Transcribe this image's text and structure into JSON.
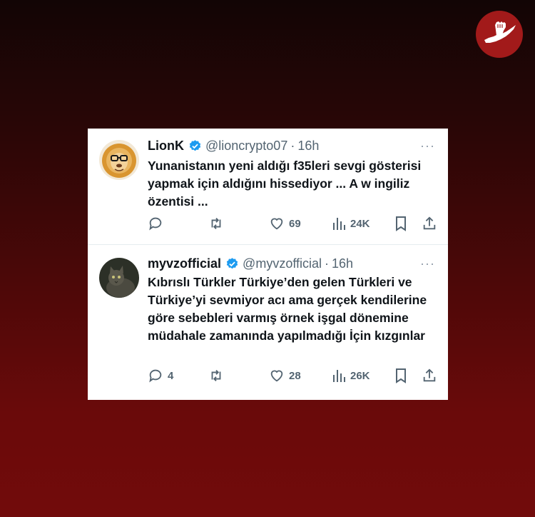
{
  "colors": {
    "background_top": "#120505",
    "background_bottom": "#720b0b",
    "logo_bg": "#a21a1a",
    "verified": "#1d9bf0",
    "name_text": "#0f1419",
    "secondary_text": "#536471"
  },
  "logo": {
    "icon": "raised-fist-island-icon"
  },
  "tweets": [
    {
      "name": "LionK",
      "handle": "@lioncrypto07",
      "dot": "·",
      "time": "16h",
      "more": "···",
      "text": "Yunanistanın yeni aldığı f35leri sevgi gösterisi yapmak için aldığını hissediyor ... A w ingiliz özentisi ...",
      "avatar_icon": "lion-avatar",
      "reply_count": "",
      "retweet_count": "",
      "like_count": "69",
      "view_count": "24K"
    },
    {
      "name": "myvzofficial",
      "handle": "@myvzofficial",
      "dot": "·",
      "time": "16h",
      "more": "···",
      "text": "Kıbrıslı Türkler Türkiye’den gelen Türkleri ve Türkiye’yi sevmiyor acı ama gerçek kendilerine göre sebebleri varmış örnek işgal dönemine müdahale zamanında yapılmadığı İçin kızgınlar",
      "avatar_icon": "cat-avatar",
      "reply_count": "4",
      "retweet_count": "",
      "like_count": "28",
      "view_count": "26K"
    }
  ]
}
